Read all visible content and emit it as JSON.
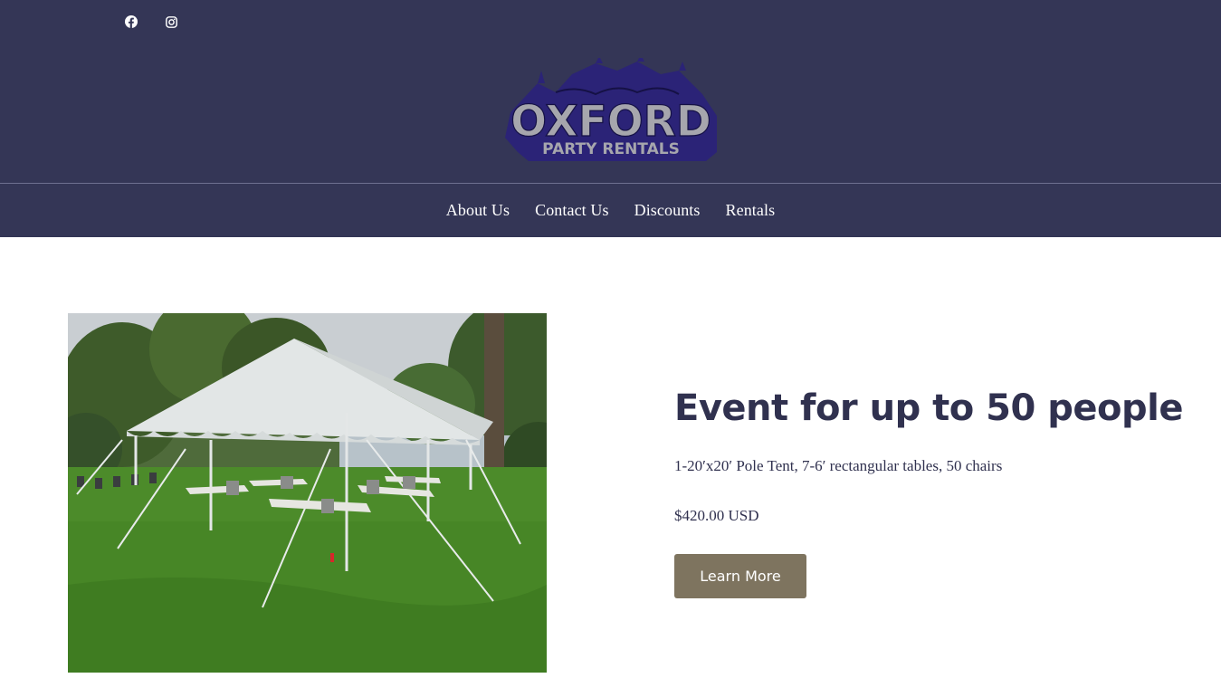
{
  "header": {
    "social": [
      {
        "name": "facebook-icon"
      },
      {
        "name": "instagram-icon"
      }
    ],
    "logo": {
      "line1": "OXFORD",
      "line2": "PARTY RENTALS"
    },
    "nav": [
      "About Us",
      "Contact Us",
      "Discounts",
      "Rentals"
    ]
  },
  "product": {
    "image_alt": "White pole tent with tables and chairs on a lawn",
    "title": "Event for up to 50 people",
    "description": "1-20′x20′ Pole Tent, 7-6′ rectangular tables, 50 chairs",
    "price": "$420.00 USD",
    "button_label": "Learn More"
  },
  "colors": {
    "header_bg": "#343656",
    "title_text": "#30314f",
    "button_bg": "#7e745f",
    "logo_purple": "#2b2377",
    "logo_gray": "#a6a6ad"
  }
}
